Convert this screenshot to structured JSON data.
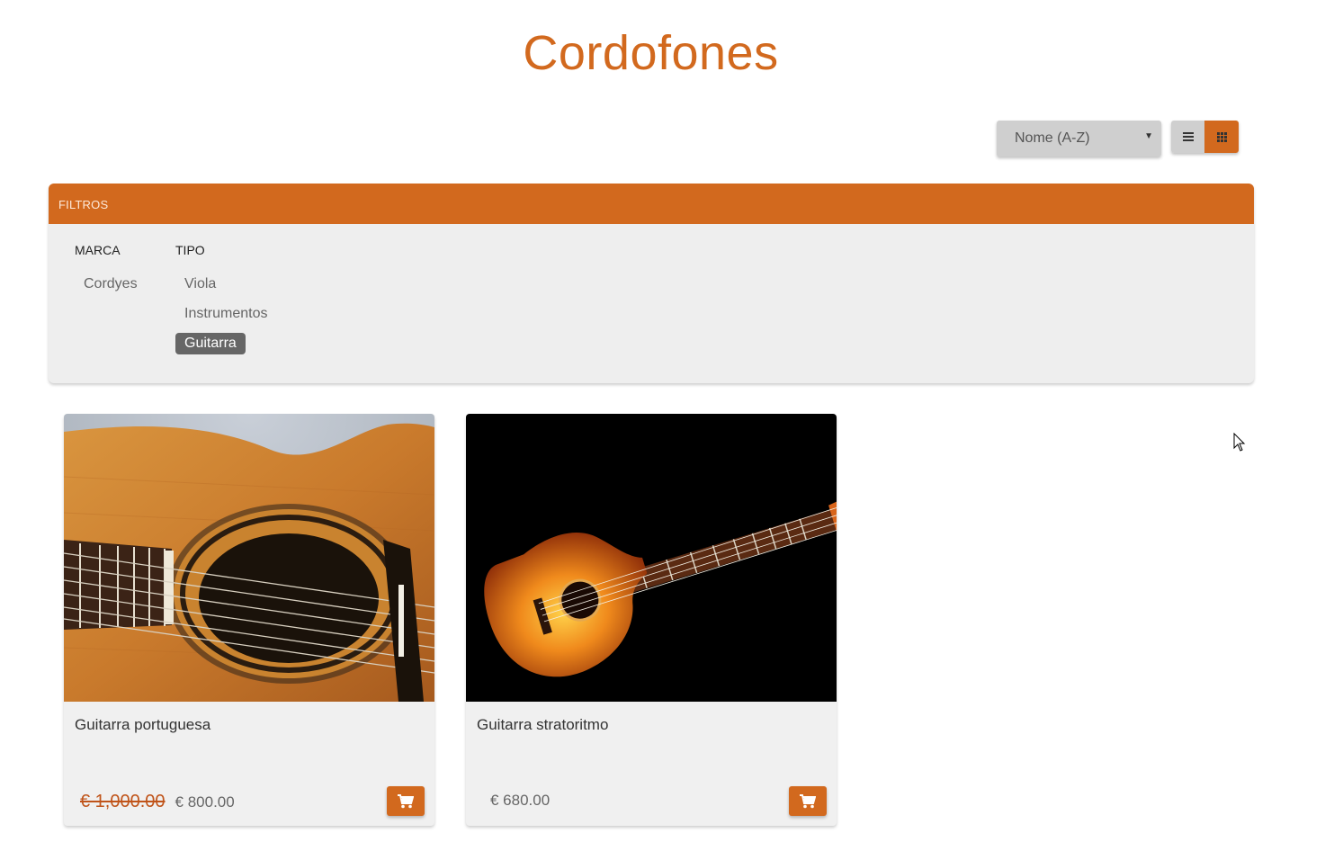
{
  "page": {
    "title": "Cordofones"
  },
  "toolbar": {
    "sort": {
      "selected": "Nome (A-Z)"
    },
    "view_modes": [
      {
        "icon": "list-icon",
        "active": false
      },
      {
        "icon": "grid-icon",
        "active": true
      }
    ]
  },
  "filters": {
    "header": "FILTROS",
    "groups": [
      {
        "heading": "MARCA",
        "options": [
          {
            "label": "Cordyes",
            "active": false
          }
        ]
      },
      {
        "heading": "TIPO",
        "options": [
          {
            "label": "Viola",
            "active": false
          },
          {
            "label": "Instrumentos",
            "active": false
          },
          {
            "label": "Guitarra",
            "active": true
          }
        ]
      }
    ]
  },
  "products": [
    {
      "name": "Guitarra portuguesa",
      "old_price": "€ 1,000.00",
      "price": "€ 800.00",
      "image": "acoustic-guitar-closeup-photo",
      "cart_icon": "cart-icon"
    },
    {
      "name": "Guitarra stratoritmo",
      "old_price": null,
      "price": "€ 680.00",
      "image": "sunburst-electro-acoustic-guitar-photo",
      "cart_icon": "cart-icon"
    }
  ],
  "colors": {
    "accent": "#d2691e",
    "panel": "#eeeeee",
    "card": "#f0f0f0",
    "active_chip": "#666666"
  }
}
